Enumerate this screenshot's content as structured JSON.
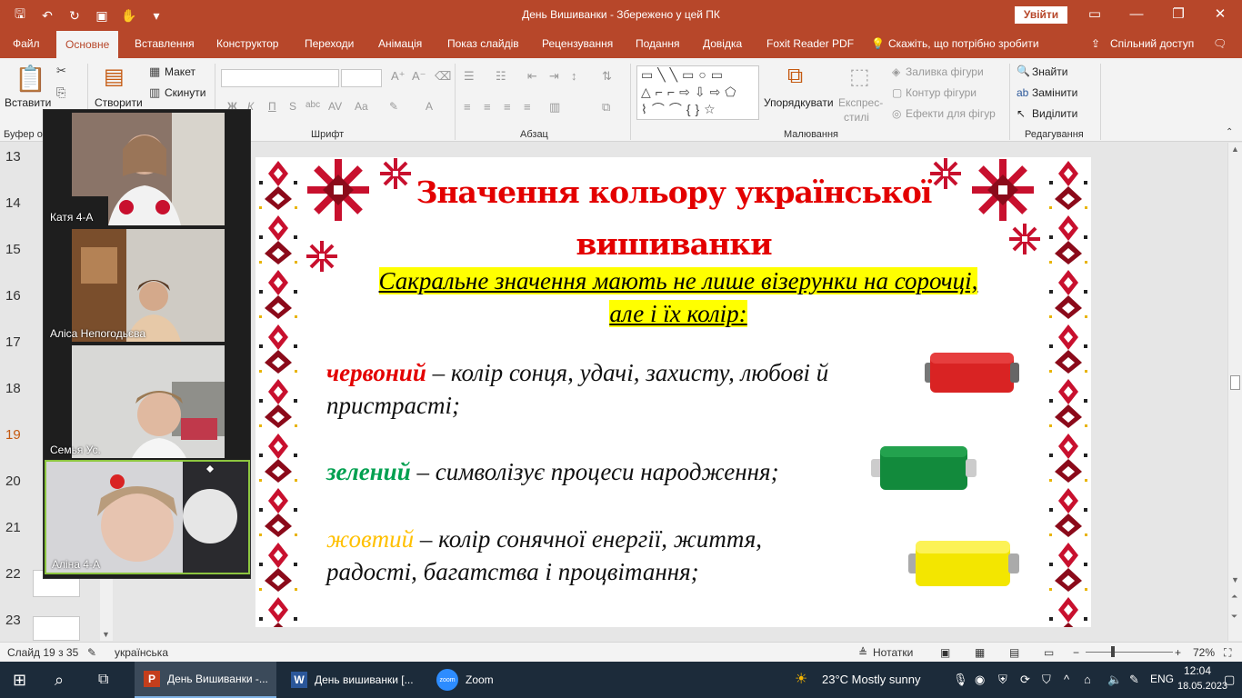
{
  "window": {
    "title": "День Вишиванки  -  Збережено у цей ПК",
    "signin_label": "Увійти"
  },
  "menu_tabs": [
    {
      "label": "Файл"
    },
    {
      "label": "Основне"
    },
    {
      "label": "Вставлення"
    },
    {
      "label": "Конструктор"
    },
    {
      "label": "Переходи"
    },
    {
      "label": "Анімація"
    },
    {
      "label": "Показ слайдів"
    },
    {
      "label": "Рецензування"
    },
    {
      "label": "Подання"
    },
    {
      "label": "Довідка"
    },
    {
      "label": "Foxit Reader PDF"
    },
    {
      "label": "Скажіть, що потрібно зробити"
    },
    {
      "label": "Спільний доступ"
    }
  ],
  "ribbon": {
    "paste_label": "Вставити",
    "create_label": "Створити",
    "layout_label": "Макет",
    "reset_label": "Скинути",
    "clipboard_group": "Буфер о",
    "font_group": "Шрифт",
    "paragraph_group": "Абзац",
    "drawing_group": "Малювання",
    "editing_group": "Редагування",
    "arrange_label": "Упорядкувати",
    "quick_styles_line1": "Експрес-",
    "quick_styles_line2": "стилі",
    "shape_fill": "Заливка фігури",
    "shape_outline": "Контур фігури",
    "shape_effects": "Ефекти для фігур",
    "find_label": "Знайти",
    "replace_label": "Замінити",
    "select_label": "Виділити",
    "bold": "Ж",
    "italic": "К",
    "underline": "П",
    "strike": "S",
    "shadow": "abc",
    "spacing": "AV",
    "case": "Aa",
    "font_color": "A"
  },
  "thumbnails": [
    {
      "num": "13"
    },
    {
      "num": "14"
    },
    {
      "num": "15"
    },
    {
      "num": "16"
    },
    {
      "num": "17"
    },
    {
      "num": "18"
    },
    {
      "num": "19"
    },
    {
      "num": "20"
    },
    {
      "num": "21"
    },
    {
      "num": "22"
    },
    {
      "num": "23"
    }
  ],
  "zoom_participants": [
    {
      "name": "Катя  4-А"
    },
    {
      "name": "Аліса Непогодьєва"
    },
    {
      "name": "Семья Ус."
    },
    {
      "name": "Аліна 4-А"
    }
  ],
  "slide": {
    "title": "Значення кольору української вишиванки",
    "subtitle_line1": "Сакральне значення мають не лише візерунки на сорочці,",
    "subtitle_line2": "але і їх колір:",
    "red_word": "червоний",
    "red_text1": " – колір сонця, удачі, захисту, любові й",
    "red_text2": "пристрасті;",
    "green_word": "зелений",
    "green_text": " – символізує процеси народження;",
    "yellow_word": "жовтий",
    "yellow_text1": " – колір сонячної енергії, життя,",
    "yellow_text2": "радості, багатства і процвітання;"
  },
  "colors": {
    "accent": "#b7472a",
    "red": "#e30000",
    "green": "#00a050",
    "yellow": "#ffc000",
    "highlight": "#ffff00"
  },
  "statusbar": {
    "slide_info": "Слайд 19 з 35",
    "language": "українська",
    "notes_label": "Нотатки",
    "zoom_level": "72%"
  },
  "taskbar": {
    "ppt_task": "День Вишиванки -...",
    "word_task": "День вишиванки [...",
    "zoom_task": "Zoom",
    "weather": "23°C  Mostly sunny",
    "lang": "ENG",
    "time": "12:04",
    "date": "18.05.2023"
  }
}
